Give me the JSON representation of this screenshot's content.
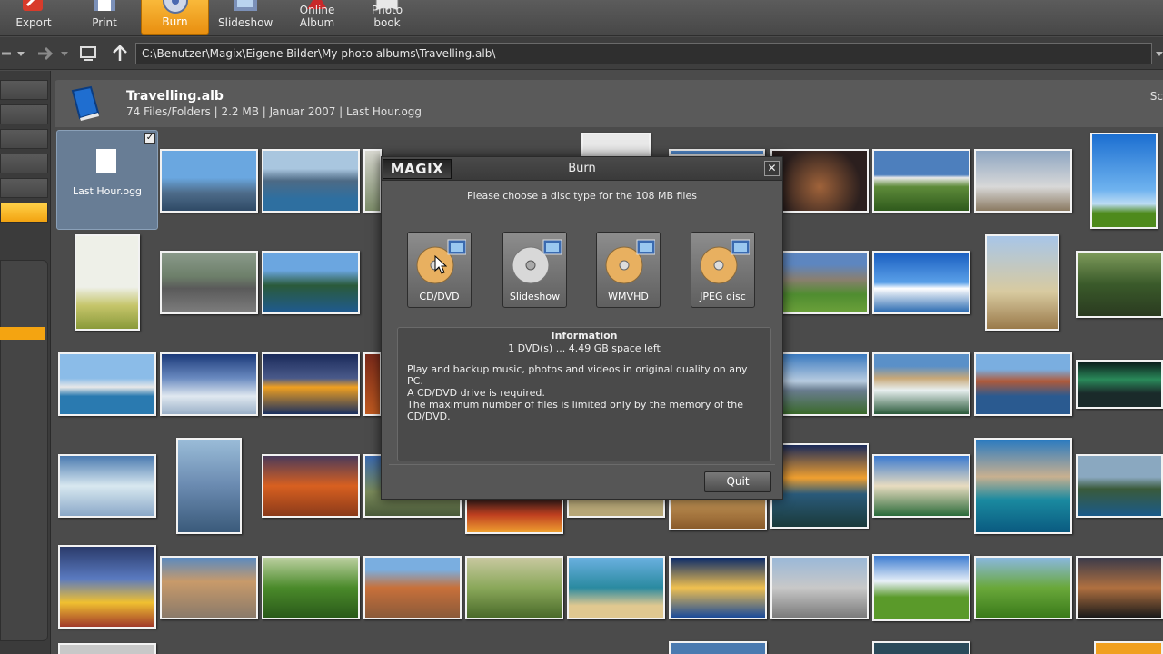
{
  "toolbar": {
    "items": [
      {
        "label": "Export",
        "icon": "export-icon"
      },
      {
        "label": "Print",
        "icon": "print-icon"
      },
      {
        "label": "Burn",
        "icon": "burn-disc-icon",
        "active": true
      },
      {
        "label": "Slideshow",
        "icon": "slideshow-icon"
      },
      {
        "label": "Online Album",
        "icon": "online-album-icon"
      },
      {
        "label": "Photo book",
        "icon": "photo-book-icon"
      }
    ]
  },
  "address": {
    "path": "C:\\Benutzer\\Magix\\Eigene Bilder\\My photo albums\\Travelling.alb\\"
  },
  "album": {
    "title": "Travelling.alb",
    "meta": "74 Files/Folders | 2.2 MB | Januar 2007 | Last Hour.ogg",
    "right_text": "Sc"
  },
  "audio_tile": {
    "name": "Last Hour.ogg",
    "checked": "✓"
  },
  "dialog": {
    "logo": "MAGIX",
    "title": "Burn",
    "close": "✕",
    "prompt": "Please choose a disc type for the 108 MB files",
    "options": [
      {
        "label": "CD/DVD",
        "icon": "cd-dvd-icon"
      },
      {
        "label": "Slideshow",
        "icon": "slideshow-disc-icon"
      },
      {
        "label": "WMVHD",
        "icon": "wmvhd-disc-icon"
      },
      {
        "label": "JPEG disc",
        "icon": "jpeg-disc-icon"
      }
    ],
    "info": {
      "heading": "Information",
      "space": "1 DVD(s) ... 4.49 GB space left",
      "lines": [
        "Play and backup music, photos and videos in original quality on any PC.",
        "A CD/DVD drive is required.",
        "The maximum number of files is limited only by the memory of the",
        "CD/DVD."
      ]
    },
    "quit_label": "Quit"
  },
  "colors": {
    "accent": "#f4a411",
    "background": "#4b4b4b",
    "dialog": "#565656"
  }
}
